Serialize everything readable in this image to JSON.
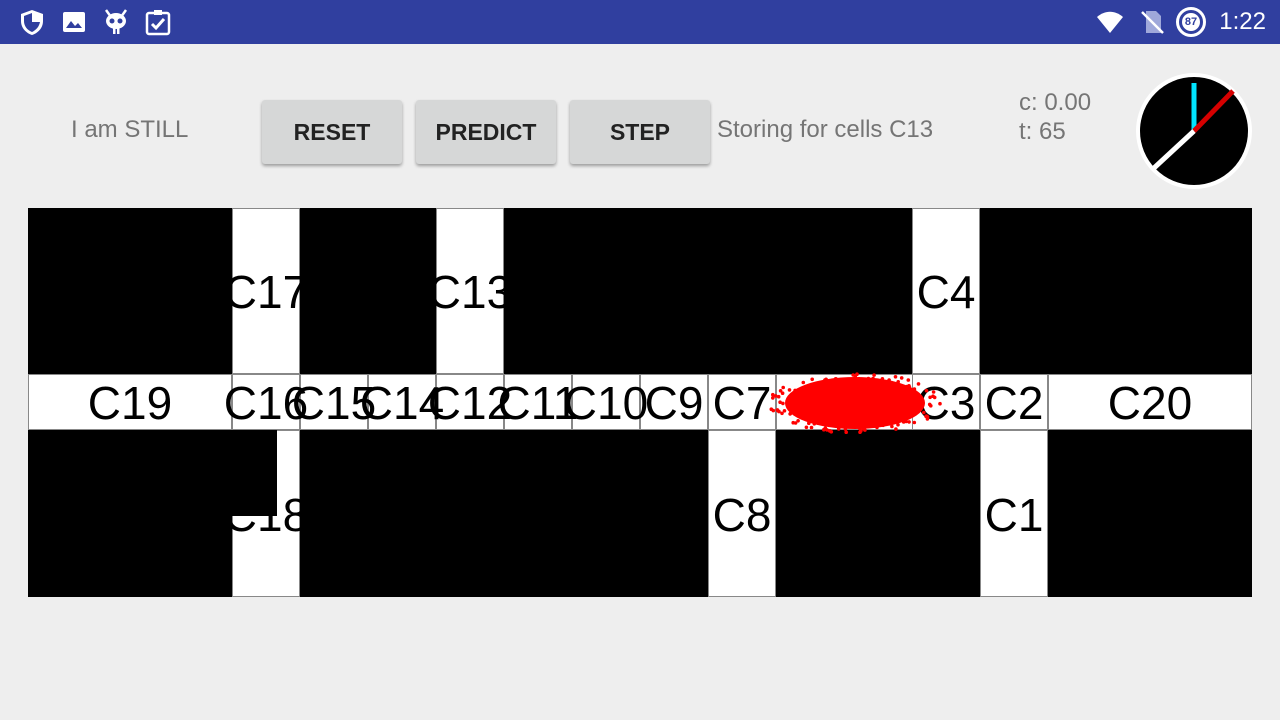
{
  "status_bar": {
    "time": "1:22",
    "battery_level": "87",
    "icons": [
      "shield-icon",
      "image-icon",
      "android-debug-icon",
      "clipboard-check-icon",
      "wifi-icon",
      "no-sim-icon",
      "battery-saver-icon"
    ]
  },
  "header": {
    "activity_text": "I am STILL",
    "buttons": {
      "reset": "RESET",
      "predict": "PREDICT",
      "step": "STEP"
    },
    "storing_text": "Storing for cells C13",
    "c_text": "c: 0.00",
    "t_text": "t: 65"
  },
  "compass": {
    "colors": {
      "face": "#000000",
      "north": "#00e5ff",
      "heading": "#d50000",
      "needle": "#ffffff"
    }
  },
  "map": {
    "cells": {
      "c1": "C1",
      "c2": "C2",
      "c3": "C3",
      "c4": "C4",
      "c7": "C7",
      "c8": "C8",
      "c9": "C9",
      "c10": "C10",
      "c11": "C11",
      "c12": "C12",
      "c13": "C13",
      "c14": "C14",
      "c15": "C15",
      "c16": "C16",
      "c17": "C17",
      "c18": "C18",
      "c19": "C19",
      "c20": "C20"
    },
    "particle_color": "#ff0000"
  }
}
